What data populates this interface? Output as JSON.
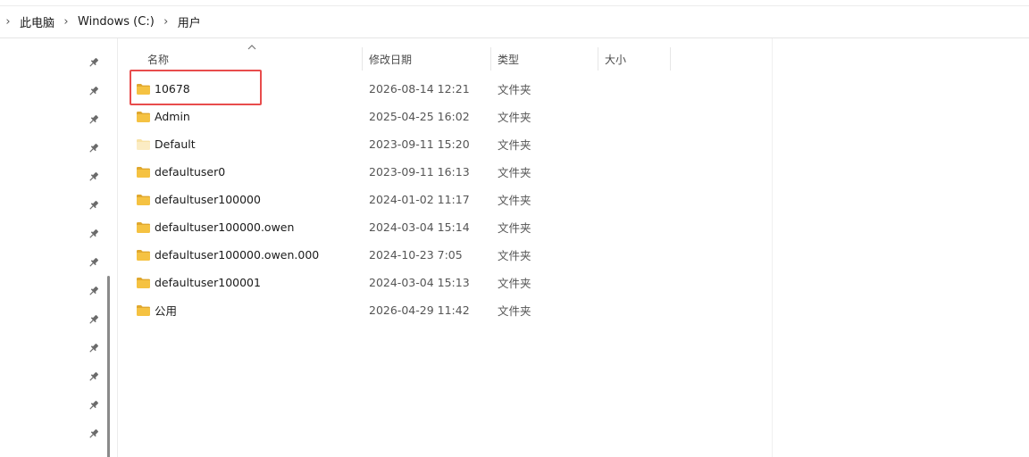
{
  "breadcrumb": {
    "items": [
      "此电脑",
      "Windows (C:)",
      "用户"
    ]
  },
  "columns": {
    "name": "名称",
    "modified": "修改日期",
    "type": "类型",
    "size": "大小"
  },
  "files": [
    {
      "name": "10678",
      "modified": "2026-08-14 12:21",
      "type": "文件夹",
      "icon": "folder-icon"
    },
    {
      "name": "Admin",
      "modified": "2025-04-25 16:02",
      "type": "文件夹",
      "icon": "folder-icon"
    },
    {
      "name": "Default",
      "modified": "2023-09-11 15:20",
      "type": "文件夹",
      "icon": "folder-hidden-icon"
    },
    {
      "name": "defaultuser0",
      "modified": "2023-09-11 16:13",
      "type": "文件夹",
      "icon": "folder-icon"
    },
    {
      "name": "defaultuser100000",
      "modified": "2024-01-02 11:17",
      "type": "文件夹",
      "icon": "folder-icon"
    },
    {
      "name": "defaultuser100000.owen",
      "modified": "2024-03-04 15:14",
      "type": "文件夹",
      "icon": "folder-icon"
    },
    {
      "name": "defaultuser100000.owen.000",
      "modified": "2024-10-23 7:05",
      "type": "文件夹",
      "icon": "folder-icon"
    },
    {
      "name": "defaultuser100001",
      "modified": "2024-03-04 15:13",
      "type": "文件夹",
      "icon": "folder-icon"
    },
    {
      "name": "公用",
      "modified": "2026-04-29 11:42",
      "type": "文件夹",
      "icon": "folder-icon"
    }
  ],
  "colors": {
    "folder": "#f5c242",
    "folder_dark": "#e0a82e",
    "folder_hidden": "#f8e2a6",
    "highlight": "#e84c4c"
  }
}
